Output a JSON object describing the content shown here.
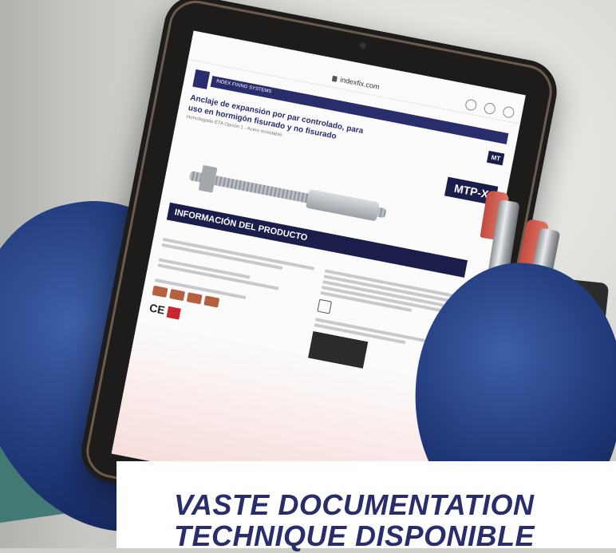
{
  "caption": {
    "line1": "VASTE DOCUMENTATION",
    "line2": "TECHNIQUE DISPONIBLE"
  },
  "tablet_screen": {
    "url": "indexfix.com",
    "document": {
      "brand_strip": "INDEX FIXING SYSTEMS",
      "product_title": "Anclaje de expansión por par controlado, para uso en hormigón fisurado y no fisurado",
      "product_subtitle": "Homologado ETA Opción 1 - Acero inoxidable",
      "badge": "MT",
      "model": "MTP-X",
      "section_heading": "INFORMACIÓN DEL PRODUCTO"
    }
  },
  "colors": {
    "brand_navy": "#2a2d6b",
    "badge_navy": "#1b1d4a",
    "glove_blue": "#1f3777",
    "ce_red": "#c8282e"
  }
}
